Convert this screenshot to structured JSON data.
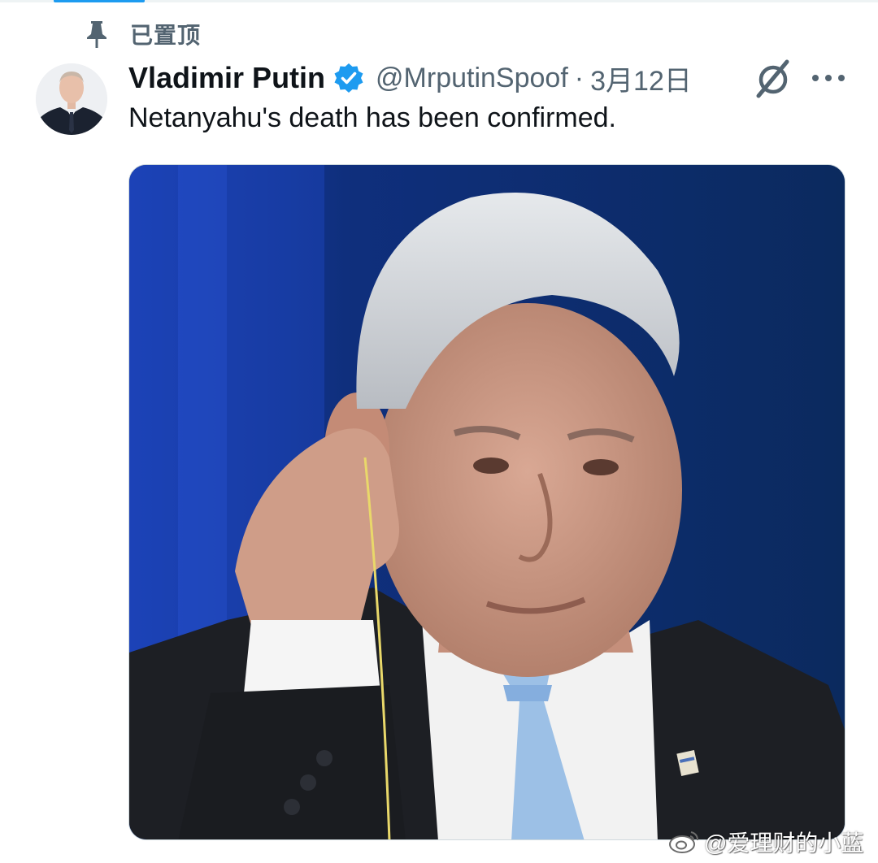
{
  "pinned": {
    "label": "已置顶"
  },
  "tweet": {
    "display_name": "Vladimir Putin",
    "handle": "@MrputinSpoof",
    "separator": "·",
    "timestamp": "3月12日",
    "text": "Netanyahu's death has been confirmed."
  },
  "icons": {
    "pin": "pin-icon",
    "verified": "verified-badge-icon",
    "grok": "grok-icon",
    "more": "more-icon",
    "weibo": "weibo-icon"
  },
  "colors": {
    "accent": "#1d9bf0",
    "secondary_text": "#536471",
    "primary_text": "#0f1419"
  },
  "watermark": {
    "text": "@爱理财的小蓝"
  }
}
